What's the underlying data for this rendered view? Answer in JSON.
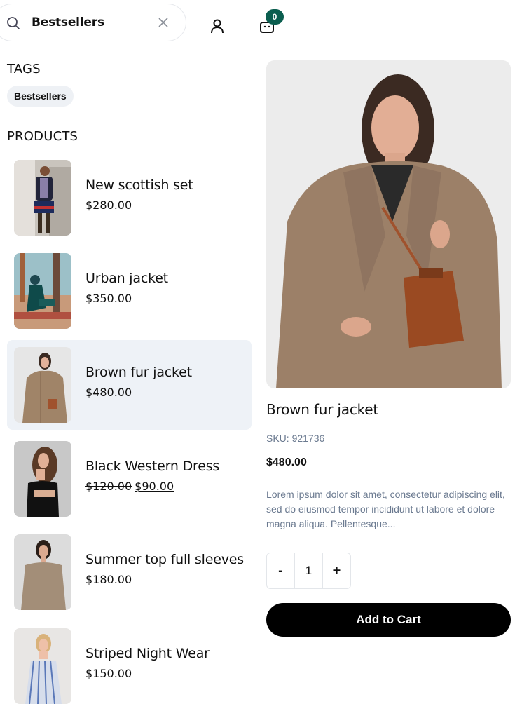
{
  "header": {
    "search_value": "Bestsellers",
    "cart_count": "0"
  },
  "tags": {
    "title": "TAGS",
    "items": [
      "Bestsellers"
    ]
  },
  "products": {
    "title": "PRODUCTS",
    "items": [
      {
        "name": "New scottish set",
        "price": "$280.00"
      },
      {
        "name": "Urban jacket",
        "price": "$350.00"
      },
      {
        "name": "Brown fur jacket",
        "price": "$480.00",
        "selected": true
      },
      {
        "name": "Black Western Dress",
        "old_price": "$120.00",
        "price": "$90.00"
      },
      {
        "name": "Summer top full sleeves",
        "price": "$180.00"
      },
      {
        "name": "Striped Night Wear",
        "price": "$150.00"
      }
    ]
  },
  "detail": {
    "name": "Brown fur jacket",
    "sku": "SKU: 921736",
    "price": "$480.00",
    "description": "Lorem ipsum dolor sit amet, consectetur adipiscing elit, sed do eiusmod tempor incididunt ut labore et dolore magna aliqua. Pellentesque...",
    "quantity": "1",
    "minus_label": "-",
    "plus_label": "+",
    "add_to_cart": "Add to Cart"
  },
  "colors": {
    "badge": "#0b5e4f",
    "selected_row": "#eef2f7",
    "muted_text": "#6b7a90",
    "button": "#000000"
  }
}
